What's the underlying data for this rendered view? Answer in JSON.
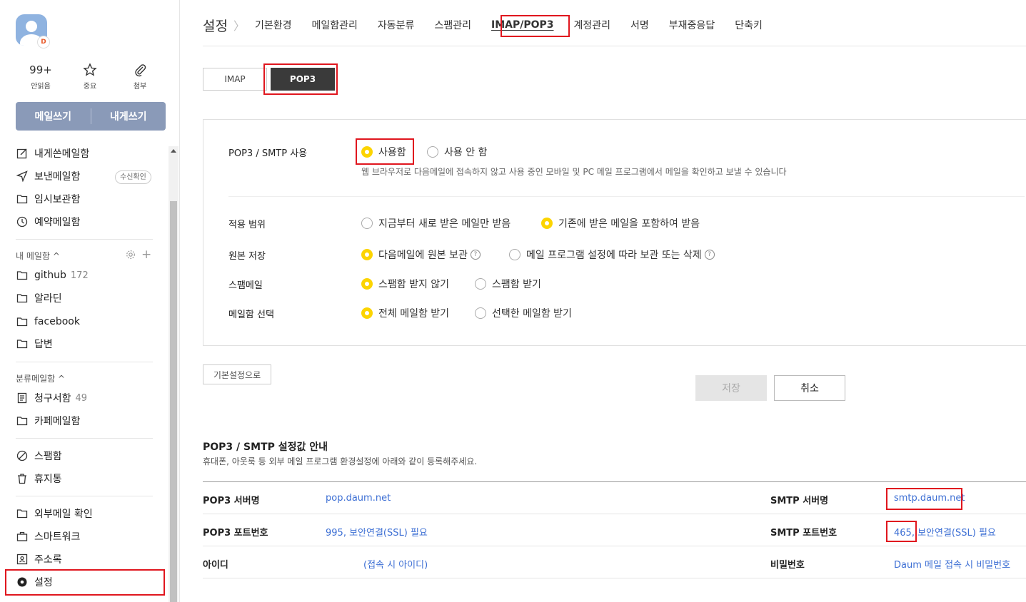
{
  "sidebar": {
    "avatar_badge": "D",
    "quick": [
      {
        "value": "99+",
        "label": "안읽음"
      },
      {
        "icon": "star-icon",
        "label": "중요"
      },
      {
        "icon": "paperclip-icon",
        "label": "첨부"
      }
    ],
    "write_label": "메일쓰기",
    "write_self_label": "내게쓰기",
    "items_top": [
      {
        "icon": "edit-icon",
        "label": "내게쓴메일함"
      },
      {
        "icon": "send-icon",
        "label": "보낸메일함",
        "badge": "수신확인"
      },
      {
        "icon": "folder-icon",
        "label": "임시보관함"
      },
      {
        "icon": "clock-icon",
        "label": "예약메일함"
      }
    ],
    "my_mailbox_title": "내 메일함",
    "my_mailbox": [
      {
        "label": "github",
        "count": "172"
      },
      {
        "label": "알라딘"
      },
      {
        "label": "facebook"
      },
      {
        "label": "답변"
      }
    ],
    "category_title": "분류메일함",
    "category": [
      {
        "label": "청구서함",
        "count": "49"
      },
      {
        "label": "카페메일함"
      }
    ],
    "misc": [
      {
        "label": "스팸함"
      },
      {
        "label": "휴지통"
      }
    ],
    "tools": [
      {
        "label": "외부메일 확인"
      },
      {
        "label": "스마트워크"
      },
      {
        "label": "주소록"
      },
      {
        "label": "설정"
      }
    ]
  },
  "header": {
    "title": "설정",
    "tabs": [
      "기본환경",
      "메일함관리",
      "자동분류",
      "스팸관리",
      "IMAP/POP3",
      "계정관리",
      "서명",
      "부재중응답",
      "단축키"
    ],
    "active_tab": "IMAP/POP3"
  },
  "proto_tabs": [
    "IMAP",
    "POP3"
  ],
  "settings": {
    "use": {
      "label": "POP3 / SMTP 사용",
      "options": [
        "사용함",
        "사용 안 함"
      ],
      "selected": 0,
      "description": "웹 브라우저로 다음메일에 접속하지 않고 사용 중인 모바일 및 PC 메일 프로그램에서 메일을 확인하고 보낼 수 있습니다"
    },
    "scope": {
      "label": "적용 범위",
      "options": [
        "지금부터 새로 받은 메일만 받음",
        "기존에 받은 메일을 포함하여 받음"
      ],
      "selected": 1
    },
    "original": {
      "label": "원본 저장",
      "options": [
        "다음메일에 원본 보관",
        "메일 프로그램 설정에 따라 보관 또는 삭제"
      ],
      "selected": 0
    },
    "spam": {
      "label": "스팸메일",
      "options": [
        "스팸함 받지 않기",
        "스팸함 받기"
      ],
      "selected": 0
    },
    "mailbox": {
      "label": "메일함 선택",
      "options": [
        "전체 메일함 받기",
        "선택한 메일함 받기"
      ],
      "selected": 0
    }
  },
  "buttons": {
    "default": "기본설정으로",
    "save": "저장",
    "cancel": "취소"
  },
  "guide": {
    "title": "POP3 / SMTP 설정값 안내",
    "subtitle": "휴대폰, 아웃룩 등 외부 메일 프로그램 환경설정에 아래와 같이 등록해주세요.",
    "pop3_server_label": "POP3 서버명",
    "pop3_server": "pop.daum.net",
    "pop3_port_label": "POP3 포트번호",
    "pop3_port": "995, 보안연결(SSL) 필요",
    "id_label": "아이디",
    "id_value": "(접속 시 아이디)",
    "smtp_server_label": "SMTP 서버명",
    "smtp_server": "smtp.daum.net",
    "smtp_port_label": "SMTP 포트번호",
    "smtp_port": "465, 보안연결(SSL) 필요",
    "pw_label": "비밀번호",
    "pw_value": "Daum 메일 접속 시 비밀번호"
  }
}
